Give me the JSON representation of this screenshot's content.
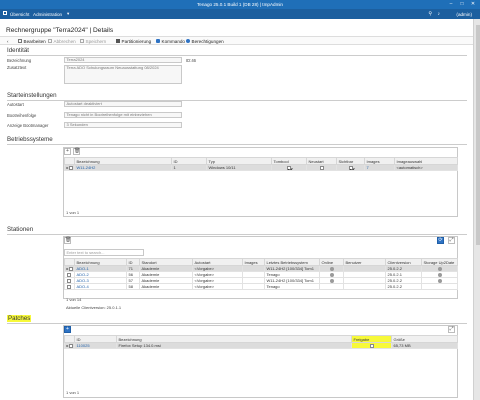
{
  "window": {
    "title": "Tenago 25.0.1 Build 1 (DB 28) | tmpAdmin"
  },
  "menu": {
    "items": [
      "Übersicht",
      "Administration"
    ],
    "user": "(admin)"
  },
  "page": {
    "title": "Rechnergruppe \"Terra2024\" | Details"
  },
  "toolbar": {
    "edit": "Bearbeiten",
    "cancel": "Abbrechen",
    "save": "Speichern",
    "partition": "Partitionierung",
    "command": "Kommando",
    "permissions": "Berechtigungen"
  },
  "identity": {
    "heading": "Identität",
    "name_label": "Bezeichnung",
    "name_value": "Terra2024",
    "id_label": "ID:46",
    "note_label": "Zusatztext",
    "note_value": "Terra ADO Schulungsraum Neuausstattung 08/2024"
  },
  "start": {
    "heading": "Starteinstellungen",
    "autostart_label": "Autostart",
    "autostart_value": "Autostart deaktiviert",
    "boot_label": "Bootreihenfolge",
    "boot_value": "Tenago nicht in Bootreihenfolge mit einbeziehen",
    "bootmanager_label": "Anzeige Bootmanager",
    "bootmanager_value": "3 Sekunden"
  },
  "systems": {
    "heading": "Betriebssysteme",
    "columns": [
      "Bezeichnung",
      "ID",
      "Typ",
      "Tombool",
      "Neustart",
      "Sichtbar",
      "Images",
      "Imageauswahl"
    ],
    "rows": [
      {
        "name": "W11-24H2",
        "id": "1",
        "type": "Windows 10/11",
        "images": "7",
        "select": "<automatisch>"
      }
    ],
    "footer": "1 von 1"
  },
  "stations": {
    "heading": "Stationen",
    "search_placeholder": "Enter text to search...",
    "columns": [
      "Bezeichnung",
      "ID",
      "Standort",
      "Autostart",
      "Images",
      "Letztes Betriebssystem",
      "Online",
      "Benutzer",
      "Clientversion",
      "Storage Up2Date"
    ],
    "rows": [
      {
        "name": "ADO-1",
        "id": "71",
        "site": "Akademie",
        "auto": "<Vorgabe>",
        "os": "W11-24H2 [100/334] Tom1",
        "ver": "25.0.2.2"
      },
      {
        "name": "ADO-2",
        "id": "56",
        "site": "Akademie",
        "auto": "<Vorgabe>",
        "os": "Tenago",
        "ver": "25.0.2.1"
      },
      {
        "name": "ADO-3",
        "id": "57",
        "site": "Akademie",
        "auto": "<Vorgabe>",
        "os": "W11-24H2 [100/334] Tom1",
        "ver": "25.0.2.2"
      },
      {
        "name": "ADO-4",
        "id": "58",
        "site": "Akademie",
        "auto": "<Vorgabe>",
        "os": "Tenago",
        "ver": "25.0.2.2"
      }
    ],
    "footer": "1 von 14",
    "client_version": "Aktuelle Clientversion: 25.0.1.1"
  },
  "patches": {
    "heading": "Patches",
    "columns": [
      "ID",
      "Bezeichnung",
      "Freigabe",
      "Größe"
    ],
    "rows": [
      {
        "id": "110025",
        "name": "Firefox Setup 134.0.msi",
        "size": "65,73 MB"
      }
    ],
    "footer": "1 von 1"
  },
  "colors": {
    "titlebar": "#1f6fb8",
    "menubar": "#1c5f9f",
    "highlight": "#f7f93a",
    "link": "#1f5fa8"
  }
}
